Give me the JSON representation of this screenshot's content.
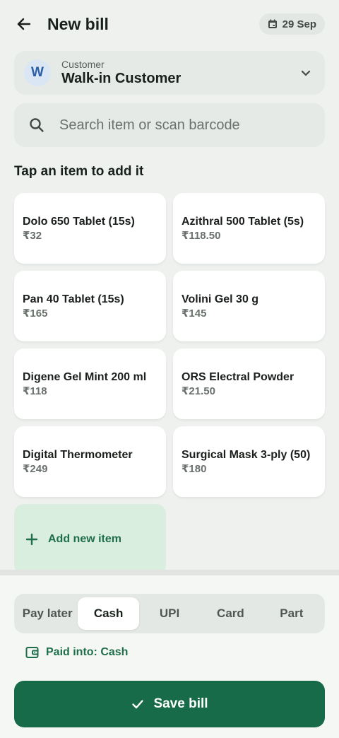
{
  "header": {
    "title": "New bill",
    "date": "29 Sep"
  },
  "customer": {
    "label": "Customer",
    "name": "Walk-in Customer",
    "initial": "W"
  },
  "search": {
    "placeholder": "Search item or scan barcode"
  },
  "section": {
    "title": "Tap an item to add it"
  },
  "items": [
    {
      "name": "Dolo 650 Tablet (15s)",
      "price": "₹32"
    },
    {
      "name": "Azithral 500 Tablet (5s)",
      "price": "₹118.50"
    },
    {
      "name": "Pan 40 Tablet (15s)",
      "price": "₹165"
    },
    {
      "name": "Volini Gel 30 g",
      "price": "₹145"
    },
    {
      "name": "Digene Gel Mint 200 ml",
      "price": "₹118"
    },
    {
      "name": "ORS Electral Powder",
      "price": "₹21.50"
    },
    {
      "name": "Digital Thermometer",
      "price": "₹249"
    },
    {
      "name": "Surgical Mask 3-ply (50)",
      "price": "₹180"
    }
  ],
  "add_item": {
    "label": "Add new item"
  },
  "payment": {
    "options": [
      "Pay later",
      "Cash",
      "UPI",
      "Card",
      "Part"
    ],
    "selected": "Cash",
    "paid_into": "Paid into: Cash"
  },
  "save": {
    "label": "Save bill"
  },
  "colors": {
    "primary": "#186b49",
    "accent_text": "#1f6e4a",
    "add_bg": "#d9eedf",
    "avatar_bg": "#dbe6f5",
    "avatar_text": "#2a5fa8"
  }
}
